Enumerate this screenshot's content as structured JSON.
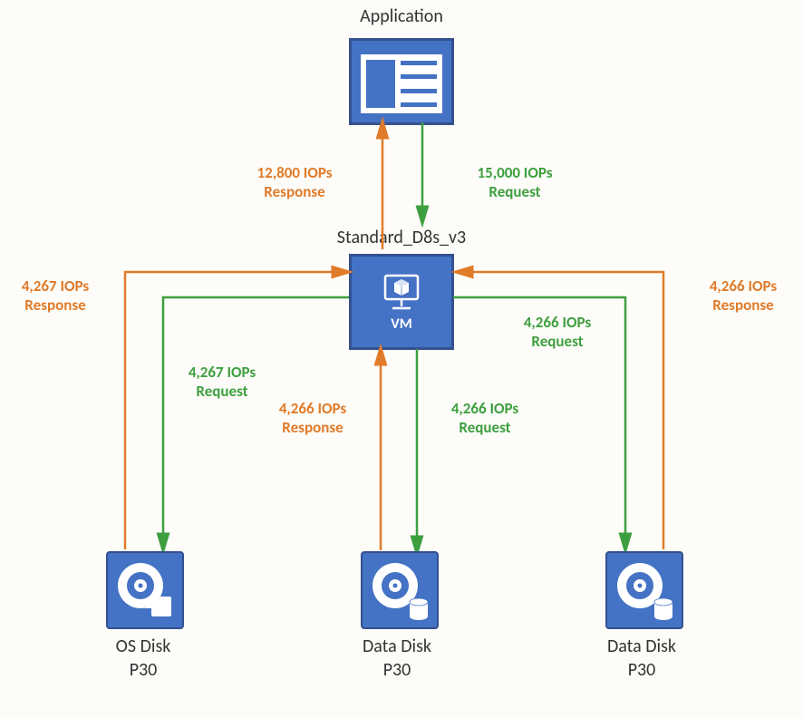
{
  "title": "Application",
  "vm": {
    "title": "Standard_D8s_v3",
    "label": "VM"
  },
  "disks": {
    "os": {
      "line1": "OS Disk",
      "line2": "P30"
    },
    "data1": {
      "line1": "Data Disk",
      "line2": "P30"
    },
    "data2": {
      "line1": "Data Disk",
      "line2": "P30"
    }
  },
  "flows": {
    "app_response": {
      "line1": "12,800 IOPs",
      "line2": "Response"
    },
    "app_request": {
      "line1": "15,000 IOPs",
      "line2": "Request"
    },
    "os_response": {
      "line1": "4,267 IOPs",
      "line2": "Response"
    },
    "os_request": {
      "line1": "4,267 IOPs",
      "line2": "Request"
    },
    "data1_response": {
      "line1": "4,266 IOPs",
      "line2": "Response"
    },
    "data1_request": {
      "line1": "4,266 IOPs",
      "line2": "Request"
    },
    "data2_response": {
      "line1": "4,266 IOPs",
      "line2": "Response"
    },
    "data2_request": {
      "line1": "4,266 IOPs",
      "line2": "Request"
    }
  }
}
